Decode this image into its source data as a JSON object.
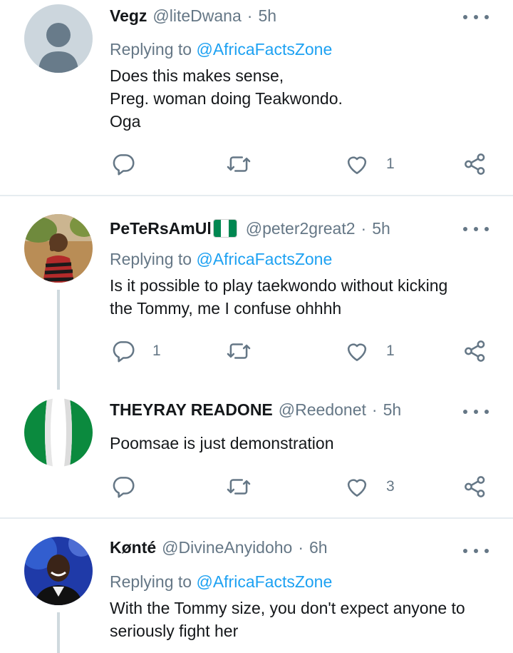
{
  "tweets": [
    {
      "name": "Vegz",
      "handle": "@liteDwana",
      "dot": "·",
      "time": "5h",
      "replying_prefix": "Replying to",
      "replying_to": "@AfricaFactsZone",
      "text": "Does this makes sense,\nPreg. woman doing Teakwondo.\nOga",
      "reply_count": "",
      "retweet_count": "",
      "like_count": "1"
    },
    {
      "name": "PeTeRsAmUl",
      "handle": "@peter2great2",
      "dot": "·",
      "time": "5h",
      "replying_prefix": "Replying to",
      "replying_to": "@AfricaFactsZone",
      "text": "Is it possible to play taekwondo without kicking\nthe Tommy, me I confuse ohhhh",
      "reply_count": "1",
      "retweet_count": "",
      "like_count": "1"
    },
    {
      "name": "THEYRAY READONE",
      "handle": "@Reedonet",
      "dot": "·",
      "time": "5h",
      "text": "Poomsae is just demonstration",
      "reply_count": "",
      "retweet_count": "",
      "like_count": "3"
    },
    {
      "name": "Kønté",
      "handle": "@DivineAnyidoho",
      "dot": "·",
      "time": "6h",
      "replying_prefix": "Replying to",
      "replying_to": "@AfricaFactsZone",
      "text": "With the Tommy size, you don't expect anyone to\nseriously fight her"
    }
  ],
  "colors": {
    "link": "#1da1f2",
    "muted": "#657786",
    "divider": "#e6ecf0",
    "thread_line": "#cfd9de",
    "flag_green": "#008751"
  }
}
